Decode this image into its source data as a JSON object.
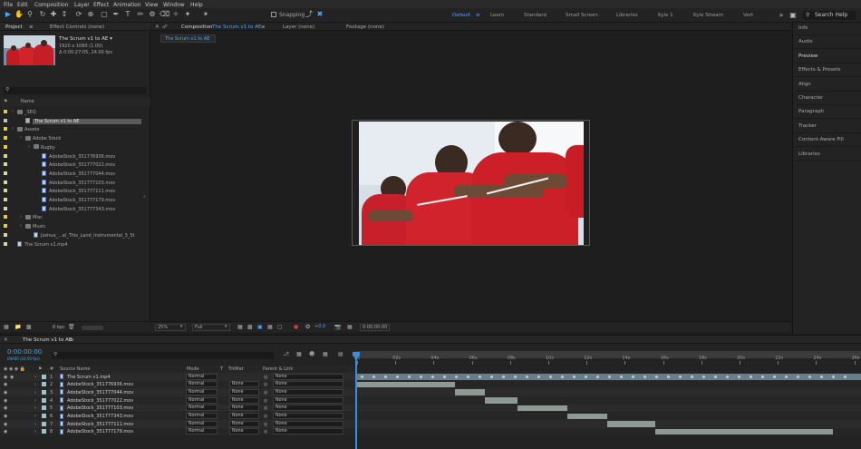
{
  "menu": [
    "File",
    "Edit",
    "Composition",
    "Layer",
    "Effect",
    "Animation",
    "View",
    "Window",
    "Help"
  ],
  "toolbar": {
    "snapping_label": "Snapping",
    "search_help": "Search Help"
  },
  "workspaces": [
    {
      "label": "Default",
      "active": true
    },
    {
      "label": "Learn"
    },
    {
      "label": "Standard"
    },
    {
      "label": "Small Screen"
    },
    {
      "label": "Libraries"
    },
    {
      "label": "Kyle 1"
    },
    {
      "label": "Kyle Stream"
    },
    {
      "label": "Vert"
    }
  ],
  "project": {
    "tab": "Project",
    "tab2": "Effect Controls (none)",
    "comp_name": "The Scrum v1 to AE ▾",
    "comp_dims": "1920 x 1080 (1.00)",
    "comp_dur": "Δ 0:00:27:05, 24.00 fps",
    "col_name": "Name",
    "items": [
      {
        "label": "_SEQ",
        "type": "folder",
        "indent": 0,
        "color": "#e6c84e"
      },
      {
        "label": "The Scrum v1 to AE",
        "type": "comp",
        "indent": 1,
        "color": "#c3c3c3",
        "selected": true
      },
      {
        "label": "Assets",
        "type": "folder",
        "indent": 0,
        "color": "#e6c84e"
      },
      {
        "label": "Adobe Stock",
        "type": "folder",
        "indent": 1,
        "color": "#e6c84e"
      },
      {
        "label": "Rugby",
        "type": "folder",
        "indent": 2,
        "color": "#e6c84e"
      },
      {
        "label": "AdobeStock_351776936.mov",
        "type": "file",
        "indent": 3,
        "color": "#d6d6a0"
      },
      {
        "label": "AdobeStock_351777022.mov",
        "type": "file",
        "indent": 3,
        "color": "#d6d6a0"
      },
      {
        "label": "AdobeStock_351777044.mov",
        "type": "file",
        "indent": 3,
        "color": "#d6d6a0"
      },
      {
        "label": "AdobeStock_351777103.mov",
        "type": "file",
        "indent": 3,
        "color": "#d6d6a0"
      },
      {
        "label": "AdobeStock_351777111.mov",
        "type": "file",
        "indent": 3,
        "color": "#d6d6a0"
      },
      {
        "label": "AdobeStock_351777179.mov",
        "type": "file",
        "indent": 3,
        "color": "#d6d6a0"
      },
      {
        "label": "AdobeStock_351777343.mov",
        "type": "file",
        "indent": 3,
        "color": "#d6d6a0"
      },
      {
        "label": "Misc",
        "type": "folder",
        "indent": 1,
        "color": "#e6c84e"
      },
      {
        "label": "Music",
        "type": "folder",
        "indent": 1,
        "color": "#e6c84e"
      },
      {
        "label": "Joshua_...al_This_Land_Instrumental_3_St",
        "type": "file",
        "indent": 2,
        "color": "#d6d6a0"
      },
      {
        "label": "The Scrum v1.mp4",
        "type": "file",
        "indent": 0,
        "color": "#d6d6a0"
      }
    ],
    "bpc": "8 bpc"
  },
  "composition": {
    "tab_prefix": "Composition",
    "tab_name": "The Scrum v1 to AE",
    "layer_tab": "Layer (none)",
    "footage_tab": "Footage (none)",
    "breadcrumb": "The Scrum v1 to AE",
    "zoom": "25%",
    "resolution": "Full",
    "exposure": "+0.0",
    "timecode": "0:00:00:00"
  },
  "side_panels": [
    "Info",
    "Audio",
    "Preview",
    "Effects & Presets",
    "Align",
    "Character",
    "Paragraph",
    "Tracker",
    "Content-Aware Fill",
    "Libraries"
  ],
  "timeline": {
    "tab": "The Scrum v1 to AE",
    "timecode": "0:00:00:00",
    "fps": "00000 (24.00 fps)",
    "cols": {
      "num": "#",
      "source": "Source Name",
      "mode": "Mode",
      "t": "T",
      "trkmat": "TrkMat",
      "parent": "Parent & Link"
    },
    "ruler": [
      "0s",
      "02s",
      "04s",
      "06s",
      "08s",
      "10s",
      "12s",
      "14s",
      "16s",
      "18s",
      "20s",
      "22s",
      "24s",
      "26s"
    ],
    "layers": [
      {
        "num": "1",
        "name": "The Scrum v1.mp4",
        "mode": "Normal",
        "trk": "",
        "parent": "None",
        "start": 0,
        "end": 27.2,
        "audio": true
      },
      {
        "num": "2",
        "name": "AdobeStock_351776936.mov",
        "mode": "Normal",
        "trk": "None",
        "parent": "None",
        "start": 0,
        "end": 5.1
      },
      {
        "num": "3",
        "name": "AdobeStock_351777044.mov",
        "mode": "Normal",
        "trk": "None",
        "parent": "None",
        "start": 5.1,
        "end": 6.7
      },
      {
        "num": "4",
        "name": "AdobeStock_351777022.mov",
        "mode": "Normal",
        "trk": "None",
        "parent": "None",
        "start": 6.7,
        "end": 8.4
      },
      {
        "num": "5",
        "name": "AdobeStock_351777103.mov",
        "mode": "Normal",
        "trk": "None",
        "parent": "None",
        "start": 8.4,
        "end": 11.0
      },
      {
        "num": "6",
        "name": "AdobeStock_351777343.mov",
        "mode": "Normal",
        "trk": "None",
        "parent": "None",
        "start": 11.0,
        "end": 13.1
      },
      {
        "num": "7",
        "name": "AdobeStock_351777111.mov",
        "mode": "Normal",
        "trk": "None",
        "parent": "None",
        "start": 13.1,
        "end": 15.6
      },
      {
        "num": "8",
        "name": "AdobeStock_351777179.mov",
        "mode": "Normal",
        "trk": "None",
        "parent": "None",
        "start": 15.6,
        "end": 24.9
      }
    ]
  }
}
